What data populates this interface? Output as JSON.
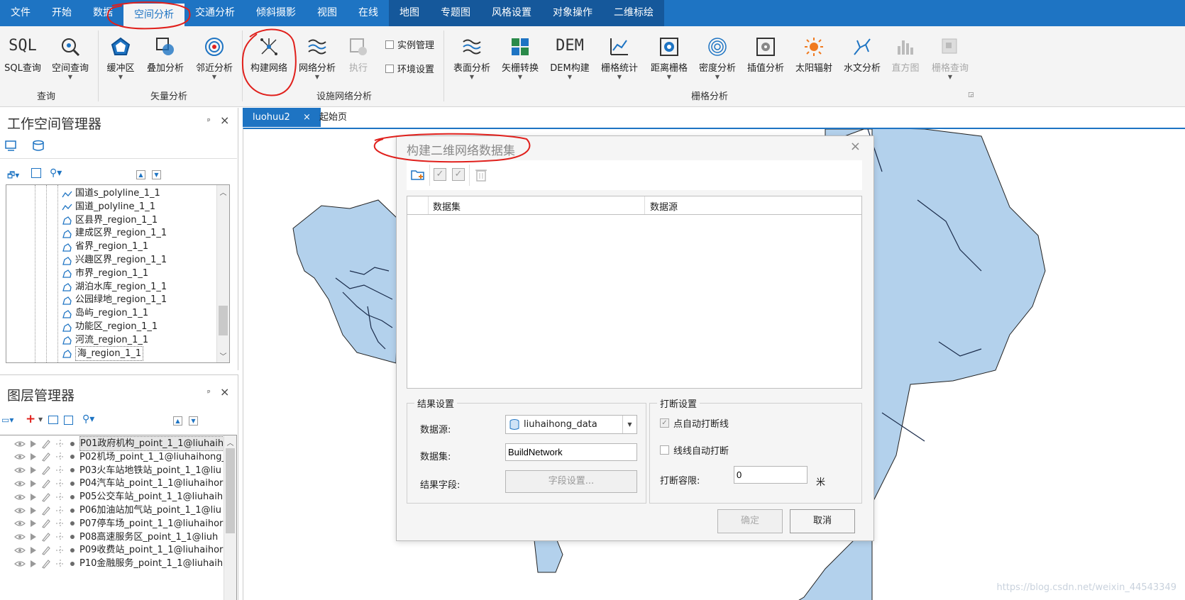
{
  "menu": {
    "tabs": [
      "文件",
      "开始",
      "数据",
      "空间分析",
      "交通分析",
      "倾斜摄影",
      "视图",
      "在线",
      "地图",
      "专题图",
      "风格设置",
      "对象操作",
      "二维标绘"
    ]
  },
  "ribbon": {
    "sql_query": "SQL查询",
    "spatial_query": "空间查询",
    "buffer": "缓冲区",
    "overlay": "叠加分析",
    "proximity": "邻近分析",
    "build_network": "构建网络",
    "network_analysis": "网络分析",
    "execute": "执行",
    "instance_manage": "实例管理",
    "env_settings": "环境设置",
    "surface": "表面分析",
    "vector_raster": "矢栅转换",
    "dem_build": "DEM构建",
    "raster_stats": "栅格统计",
    "distance_raster": "距离栅格",
    "density": "密度分析",
    "interpolation": "插值分析",
    "solar": "太阳辐射",
    "hydrology": "水文分析",
    "histogram": "直方图",
    "raster_query": "栅格查询",
    "group_query": "查询",
    "group_vector": "矢量分析",
    "group_network": "设施网络分析",
    "group_raster": "栅格分析",
    "sql_glyph": "SQL",
    "dem_glyph": "DEM"
  },
  "workspace": {
    "title": "工作空间管理器",
    "pin": "ᵖ",
    "close": "×",
    "items": [
      {
        "label": "国道s_polyline_1_1",
        "type": "line"
      },
      {
        "label": "国道_polyline_1_1",
        "type": "line"
      },
      {
        "label": "区县界_region_1_1",
        "type": "region"
      },
      {
        "label": "建成区界_region_1_1",
        "type": "region"
      },
      {
        "label": "省界_region_1_1",
        "type": "region"
      },
      {
        "label": "兴趣区界_region_1_1",
        "type": "region"
      },
      {
        "label": "市界_region_1_1",
        "type": "region"
      },
      {
        "label": "湖泊水库_region_1_1",
        "type": "region"
      },
      {
        "label": "公园绿地_region_1_1",
        "type": "region"
      },
      {
        "label": "岛屿_region_1_1",
        "type": "region"
      },
      {
        "label": "功能区_region_1_1",
        "type": "region"
      },
      {
        "label": "河流_region_1_1",
        "type": "region"
      },
      {
        "label": "海_region_1_1",
        "type": "region"
      }
    ]
  },
  "layers": {
    "title": "图层管理器",
    "pin": "ᵖ",
    "close": "×",
    "items": [
      "P01政府机构_point_1_1@liuhaih",
      "P02机场_point_1_1@liuhaihong_",
      "P03火车站地铁站_point_1_1@liu",
      "P04汽车站_point_1_1@liuhaihor",
      "P05公交车站_point_1_1@liuhaih",
      "P06加油站加气站_point_1_1@liu",
      "P07停车场_point_1_1@liuhaihor",
      "P08高速服务区_point_1_1@liuh",
      "P09收费站_point_1_1@liuhaihor",
      "P10金融服务_point_1_1@liuhaih"
    ]
  },
  "doc_tabs": {
    "active": "luohuu2",
    "active_close": "×",
    "other": "起始页"
  },
  "dialog": {
    "title": "构建二维网络数据集",
    "close": "×",
    "table_headers": [
      "数据集",
      "数据源"
    ],
    "result": {
      "legend": "结果设置",
      "datasource_label": "数据源:",
      "datasource_value": "liuhaihong_data",
      "dataset_label": "数据集:",
      "dataset_value": "BuildNetwork",
      "field_label": "结果字段:",
      "field_button": "字段设置..."
    },
    "break": {
      "legend": "打断设置",
      "point_auto": "点自动打断线",
      "point_auto_checked": true,
      "line_auto": "线线自动打断",
      "line_auto_checked": false,
      "tolerance_label": "打断容限:",
      "tolerance_value": "0",
      "unit": "米"
    },
    "ok": "确定",
    "cancel": "取消"
  },
  "watermark": "https://blog.csdn.net/weixin_44543349",
  "colors": {
    "menu_blue": "#1e74c3",
    "map_fill": "#b3d1ec",
    "annotation_red": "#e0201c"
  }
}
